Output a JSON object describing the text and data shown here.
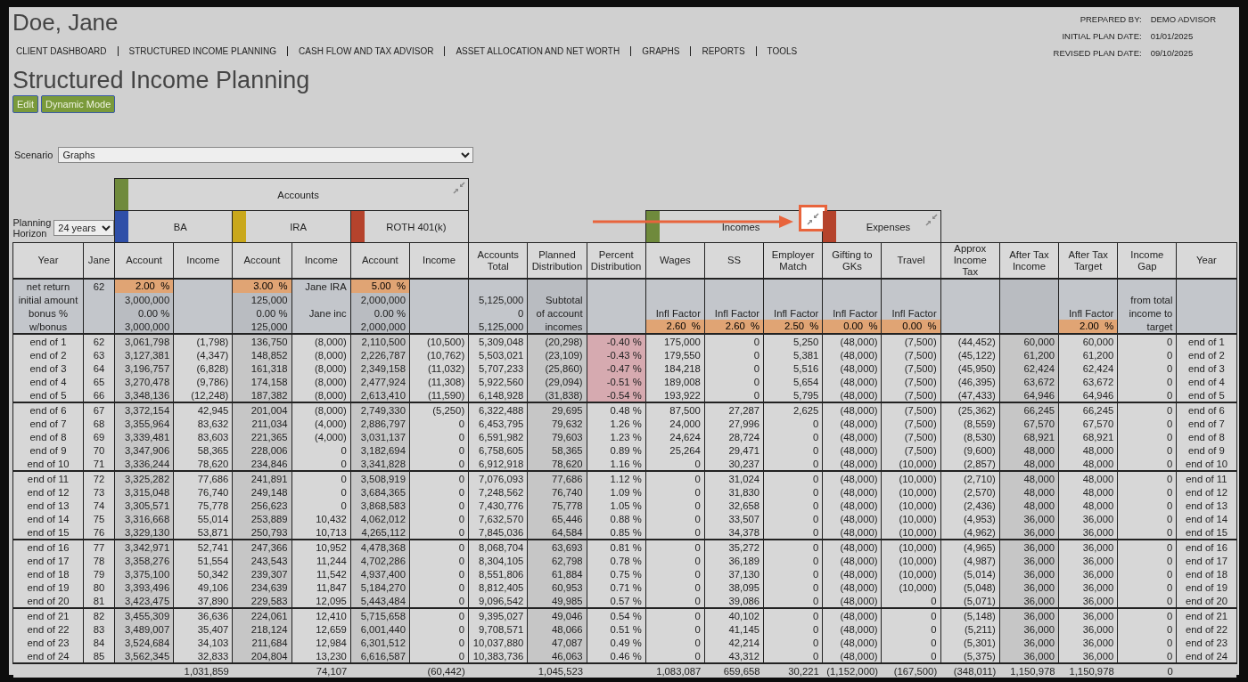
{
  "client_name": "Doe, Jane",
  "nav": [
    "CLIENT DASHBOARD",
    "STRUCTURED INCOME PLANNING",
    "CASH FLOW AND TAX ADVISOR",
    "ASSET ALLOCATION AND NET WORTH",
    "GRAPHS",
    "REPORTS",
    "TOOLS"
  ],
  "plan_info": [
    {
      "label": "PREPARED BY:",
      "value": "DEMO ADVISOR"
    },
    {
      "label": "INITIAL PLAN DATE:",
      "value": "01/01/2025"
    },
    {
      "label": "REVISED PLAN DATE:",
      "value": "09/10/2025"
    }
  ],
  "page_title": "Structured Income Planning",
  "buttons": [
    "Edit",
    "Dynamic Mode"
  ],
  "scenario": {
    "label": "Scenario",
    "value": "Graphs"
  },
  "planning_horizon": {
    "label": "Planning Horizon",
    "value": "24 years"
  },
  "account_group": {
    "label": "Accounts",
    "color": "#6f8a3c"
  },
  "accounts": [
    {
      "label": "BA",
      "color": "#2f4fa8"
    },
    {
      "label": "IRA",
      "color": "#c9a81c"
    },
    {
      "label": "ROTH 401(k)",
      "color": "#b5432c"
    }
  ],
  "flow_groups": [
    {
      "label": "Incomes",
      "color": "#6f8a3c",
      "highlighted": true
    },
    {
      "label": "Expenses",
      "color": "#b5432c",
      "highlighted": false
    }
  ],
  "columns": [
    {
      "label": "Year",
      "shaded": false
    },
    {
      "label": "Jane",
      "shaded": false
    },
    {
      "label": "Account",
      "shaded": true
    },
    {
      "label": "Income",
      "shaded": false,
      "total": "1,031,859"
    },
    {
      "label": "Account",
      "shaded": true
    },
    {
      "label": "Income",
      "shaded": false,
      "total": "74,107"
    },
    {
      "label": "Account",
      "shaded": true
    },
    {
      "label": "Income",
      "shaded": false,
      "total": "(60,442)"
    },
    {
      "label": "Accounts Total",
      "shaded": false
    },
    {
      "label": "Planned Distribution",
      "shaded": true,
      "total": "1,045,523"
    },
    {
      "label": "Percent Distribution",
      "shaded": false
    },
    {
      "label": "Wages",
      "shaded": false,
      "total": "1,083,087"
    },
    {
      "label": "SS",
      "shaded": false,
      "total": "659,658"
    },
    {
      "label": "Employer Match",
      "shaded": false,
      "total": "30,221"
    },
    {
      "label": "Gifting to GKs",
      "shaded": false,
      "total": "(1,152,000)"
    },
    {
      "label": "Travel",
      "shaded": false,
      "total": "(167,500)"
    },
    {
      "label": "Approx Income Tax",
      "shaded": false,
      "total": "(348,011)"
    },
    {
      "label": "After Tax Income",
      "shaded": true,
      "total": "1,150,978"
    },
    {
      "label": "After Tax Target",
      "shaded": false,
      "total": "1,150,978"
    },
    {
      "label": "Income Gap",
      "shaded": false,
      "total": "0"
    },
    {
      "label": "Year",
      "shaded": false
    }
  ],
  "setup": [
    {
      "cells": [
        "net return",
        "62",
        {
          "text": "2.00  %",
          "input": true
        },
        null,
        {
          "text": "3.00  %",
          "input": true
        },
        "Jane IRA",
        {
          "text": "5.00  %",
          "input": true
        },
        null,
        null,
        null,
        null,
        null,
        null,
        null,
        null,
        null,
        null,
        null,
        null,
        null,
        null
      ]
    },
    {
      "cells": [
        "initial amount",
        null,
        "3,000,000",
        null,
        "125,000",
        null,
        "2,000,000",
        null,
        "5,125,000",
        "Subtotal",
        null,
        null,
        null,
        null,
        null,
        null,
        null,
        null,
        null,
        "from total",
        null
      ]
    },
    {
      "cells": [
        "bonus %",
        null,
        "0.00  %",
        null,
        "0.00  %",
        "Jane inc",
        "0.00  %",
        null,
        "0",
        "of account",
        null,
        "Infl Factor",
        "Infl Factor",
        "Infl Factor",
        "Infl Factor",
        "Infl Factor",
        null,
        null,
        "Infl Factor",
        "income to",
        null
      ]
    },
    {
      "cells": [
        "w/bonus",
        null,
        "3,000,000",
        null,
        "125,000",
        null,
        "2,000,000",
        null,
        "5,125,000",
        "incomes",
        null,
        {
          "text": "2.60  %",
          "input": true
        },
        {
          "text": "2.60  %",
          "input": true
        },
        {
          "text": "2.50  %",
          "input": true
        },
        {
          "text": "0.00  %",
          "input": true
        },
        {
          "text": "0.00  %",
          "input": true
        },
        null,
        null,
        {
          "text": "2.00  %",
          "input": true
        },
        "target",
        null
      ]
    }
  ],
  "rows": [
    {
      "flagged": true,
      "cells": [
        "end of 1",
        "62",
        "3,061,798",
        "(1,798)",
        "136,750",
        "(8,000)",
        "2,110,500",
        "(10,500)",
        "5,309,048",
        "(20,298)",
        "-0.40  %",
        "175,000",
        "0",
        "5,250",
        "(48,000)",
        "(7,500)",
        "(44,452)",
        "60,000",
        "60,000",
        "0",
        "end of 1"
      ]
    },
    {
      "flagged": true,
      "cells": [
        "end of 2",
        "63",
        "3,127,381",
        "(4,347)",
        "148,852",
        "(8,000)",
        "2,226,787",
        "(10,762)",
        "5,503,021",
        "(23,109)",
        "-0.43  %",
        "179,550",
        "0",
        "5,381",
        "(48,000)",
        "(7,500)",
        "(45,122)",
        "61,200",
        "61,200",
        "0",
        "end of 2"
      ]
    },
    {
      "flagged": true,
      "cells": [
        "end of 3",
        "64",
        "3,196,757",
        "(6,828)",
        "161,318",
        "(8,000)",
        "2,349,158",
        "(11,032)",
        "5,707,233",
        "(25,860)",
        "-0.47  %",
        "184,218",
        "0",
        "5,516",
        "(48,000)",
        "(7,500)",
        "(45,950)",
        "62,424",
        "62,424",
        "0",
        "end of 3"
      ]
    },
    {
      "flagged": true,
      "cells": [
        "end of 4",
        "65",
        "3,270,478",
        "(9,786)",
        "174,158",
        "(8,000)",
        "2,477,924",
        "(11,308)",
        "5,922,560",
        "(29,094)",
        "-0.51  %",
        "189,008",
        "0",
        "5,654",
        "(48,000)",
        "(7,500)",
        "(46,395)",
        "63,672",
        "63,672",
        "0",
        "end of 4"
      ]
    },
    {
      "flagged": true,
      "cells": [
        "end of 5",
        "66",
        "3,348,136",
        "(12,248)",
        "187,382",
        "(8,000)",
        "2,613,410",
        "(11,590)",
        "6,148,928",
        "(31,838)",
        "-0.54  %",
        "193,922",
        "0",
        "5,795",
        "(48,000)",
        "(7,500)",
        "(47,433)",
        "64,946",
        "64,946",
        "0",
        "end of 5"
      ]
    },
    {
      "flagged": false,
      "cells": [
        "end of 6",
        "67",
        "3,372,154",
        "42,945",
        "201,004",
        "(8,000)",
        "2,749,330",
        "(5,250)",
        "6,322,488",
        "29,695",
        "0.48  %",
        "87,500",
        "27,287",
        "2,625",
        "(48,000)",
        "(7,500)",
        "(25,362)",
        "66,245",
        "66,245",
        "0",
        "end of 6"
      ]
    },
    {
      "flagged": false,
      "cells": [
        "end of 7",
        "68",
        "3,355,964",
        "83,632",
        "211,034",
        "(4,000)",
        "2,886,797",
        "0",
        "6,453,795",
        "79,632",
        "1.26  %",
        "24,000",
        "27,996",
        "0",
        "(48,000)",
        "(7,500)",
        "(8,559)",
        "67,570",
        "67,570",
        "0",
        "end of 7"
      ]
    },
    {
      "flagged": false,
      "cells": [
        "end of 8",
        "69",
        "3,339,481",
        "83,603",
        "221,365",
        "(4,000)",
        "3,031,137",
        "0",
        "6,591,982",
        "79,603",
        "1.23  %",
        "24,624",
        "28,724",
        "0",
        "(48,000)",
        "(7,500)",
        "(8,530)",
        "68,921",
        "68,921",
        "0",
        "end of 8"
      ]
    },
    {
      "flagged": false,
      "cells": [
        "end of 9",
        "70",
        "3,347,906",
        "58,365",
        "228,006",
        "0",
        "3,182,694",
        "0",
        "6,758,605",
        "58,365",
        "0.89  %",
        "25,264",
        "29,471",
        "0",
        "(48,000)",
        "(7,500)",
        "(9,600)",
        "48,000",
        "48,000",
        "0",
        "end of 9"
      ]
    },
    {
      "flagged": false,
      "cells": [
        "end of 10",
        "71",
        "3,336,244",
        "78,620",
        "234,846",
        "0",
        "3,341,828",
        "0",
        "6,912,918",
        "78,620",
        "1.16  %",
        "0",
        "30,237",
        "0",
        "(48,000)",
        "(10,000)",
        "(2,857)",
        "48,000",
        "48,000",
        "0",
        "end of 10"
      ]
    },
    {
      "flagged": false,
      "cells": [
        "end of 11",
        "72",
        "3,325,282",
        "77,686",
        "241,891",
        "0",
        "3,508,919",
        "0",
        "7,076,093",
        "77,686",
        "1.12  %",
        "0",
        "31,024",
        "0",
        "(48,000)",
        "(10,000)",
        "(2,710)",
        "48,000",
        "48,000",
        "0",
        "end of 11"
      ]
    },
    {
      "flagged": false,
      "cells": [
        "end of 12",
        "73",
        "3,315,048",
        "76,740",
        "249,148",
        "0",
        "3,684,365",
        "0",
        "7,248,562",
        "76,740",
        "1.09  %",
        "0",
        "31,830",
        "0",
        "(48,000)",
        "(10,000)",
        "(2,570)",
        "48,000",
        "48,000",
        "0",
        "end of 12"
      ]
    },
    {
      "flagged": false,
      "cells": [
        "end of 13",
        "74",
        "3,305,571",
        "75,778",
        "256,623",
        "0",
        "3,868,583",
        "0",
        "7,430,776",
        "75,778",
        "1.05  %",
        "0",
        "32,658",
        "0",
        "(48,000)",
        "(10,000)",
        "(2,436)",
        "48,000",
        "48,000",
        "0",
        "end of 13"
      ]
    },
    {
      "flagged": false,
      "cells": [
        "end of 14",
        "75",
        "3,316,668",
        "55,014",
        "253,889",
        "10,432",
        "4,062,012",
        "0",
        "7,632,570",
        "65,446",
        "0.88  %",
        "0",
        "33,507",
        "0",
        "(48,000)",
        "(10,000)",
        "(4,953)",
        "36,000",
        "36,000",
        "0",
        "end of 14"
      ]
    },
    {
      "flagged": false,
      "cells": [
        "end of 15",
        "76",
        "3,329,130",
        "53,871",
        "250,793",
        "10,713",
        "4,265,112",
        "0",
        "7,845,036",
        "64,584",
        "0.85  %",
        "0",
        "34,378",
        "0",
        "(48,000)",
        "(10,000)",
        "(4,962)",
        "36,000",
        "36,000",
        "0",
        "end of 15"
      ]
    },
    {
      "flagged": false,
      "cells": [
        "end of 16",
        "77",
        "3,342,971",
        "52,741",
        "247,366",
        "10,952",
        "4,478,368",
        "0",
        "8,068,704",
        "63,693",
        "0.81  %",
        "0",
        "35,272",
        "0",
        "(48,000)",
        "(10,000)",
        "(4,965)",
        "36,000",
        "36,000",
        "0",
        "end of 16"
      ]
    },
    {
      "flagged": false,
      "cells": [
        "end of 17",
        "78",
        "3,358,276",
        "51,554",
        "243,543",
        "11,244",
        "4,702,286",
        "0",
        "8,304,105",
        "62,798",
        "0.78  %",
        "0",
        "36,189",
        "0",
        "(48,000)",
        "(10,000)",
        "(4,987)",
        "36,000",
        "36,000",
        "0",
        "end of 17"
      ]
    },
    {
      "flagged": false,
      "cells": [
        "end of 18",
        "79",
        "3,375,100",
        "50,342",
        "239,307",
        "11,542",
        "4,937,400",
        "0",
        "8,551,806",
        "61,884",
        "0.75  %",
        "0",
        "37,130",
        "0",
        "(48,000)",
        "(10,000)",
        "(5,014)",
        "36,000",
        "36,000",
        "0",
        "end of 18"
      ]
    },
    {
      "flagged": false,
      "cells": [
        "end of 19",
        "80",
        "3,393,496",
        "49,106",
        "234,639",
        "11,847",
        "5,184,270",
        "0",
        "8,812,405",
        "60,953",
        "0.71  %",
        "0",
        "38,095",
        "0",
        "(48,000)",
        "(10,000)",
        "(5,048)",
        "36,000",
        "36,000",
        "0",
        "end of 19"
      ]
    },
    {
      "flagged": false,
      "cells": [
        "end of 20",
        "81",
        "3,423,475",
        "37,890",
        "229,583",
        "12,095",
        "5,443,484",
        "0",
        "9,096,542",
        "49,985",
        "0.57  %",
        "0",
        "39,086",
        "0",
        "(48,000)",
        "0",
        "(5,071)",
        "36,000",
        "36,000",
        "0",
        "end of 20"
      ]
    },
    {
      "flagged": false,
      "cells": [
        "end of 21",
        "82",
        "3,455,309",
        "36,636",
        "224,061",
        "12,410",
        "5,715,658",
        "0",
        "9,395,027",
        "49,046",
        "0.54  %",
        "0",
        "40,102",
        "0",
        "(48,000)",
        "0",
        "(5,148)",
        "36,000",
        "36,000",
        "0",
        "end of 21"
      ]
    },
    {
      "flagged": false,
      "cells": [
        "end of 22",
        "83",
        "3,489,007",
        "35,407",
        "218,124",
        "12,659",
        "6,001,440",
        "0",
        "9,708,571",
        "48,066",
        "0.51  %",
        "0",
        "41,145",
        "0",
        "(48,000)",
        "0",
        "(5,211)",
        "36,000",
        "36,000",
        "0",
        "end of 22"
      ]
    },
    {
      "flagged": false,
      "cells": [
        "end of 23",
        "84",
        "3,524,684",
        "34,103",
        "211,684",
        "12,984",
        "6,301,512",
        "0",
        "10,037,880",
        "47,087",
        "0.49  %",
        "0",
        "42,214",
        "0",
        "(48,000)",
        "0",
        "(5,301)",
        "36,000",
        "36,000",
        "0",
        "end of 23"
      ]
    },
    {
      "flagged": false,
      "cells": [
        "end of 24",
        "85",
        "3,562,345",
        "32,833",
        "204,804",
        "13,230",
        "6,616,587",
        "0",
        "10,383,736",
        "46,063",
        "0.46  %",
        "0",
        "43,312",
        "0",
        "(48,000)",
        "0",
        "(5,375)",
        "36,000",
        "36,000",
        "0",
        "end of 24"
      ]
    }
  ],
  "footer": {
    "kind": "totals"
  }
}
